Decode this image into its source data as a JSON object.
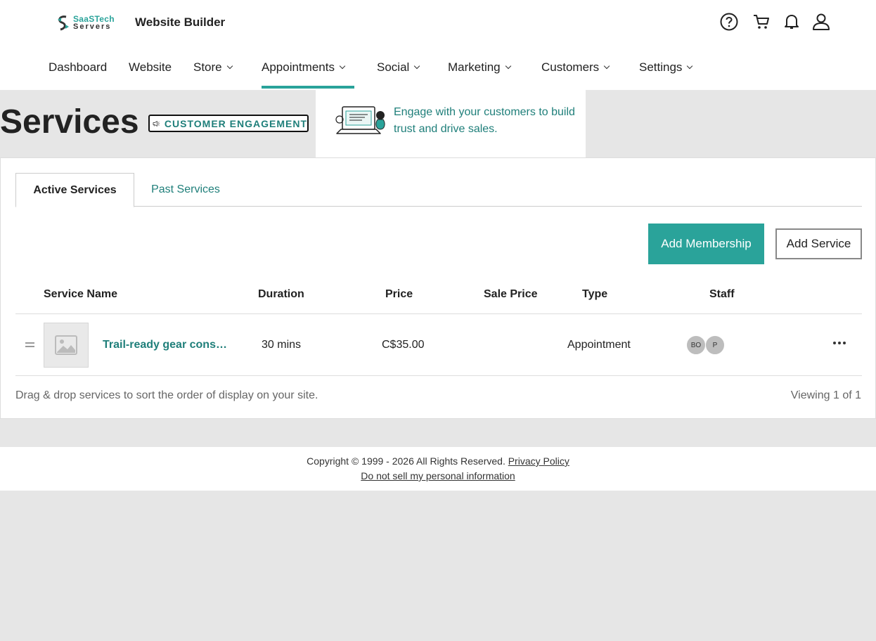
{
  "brand": {
    "logo_line1": "SaaSTech",
    "logo_line2": "Servers",
    "app_title": "Website Builder"
  },
  "header_icons": [
    "help-icon",
    "cart-icon",
    "bell-icon",
    "user-icon"
  ],
  "nav": {
    "items": [
      {
        "label": "Dashboard",
        "dropdown": false
      },
      {
        "label": "Website",
        "dropdown": false
      },
      {
        "label": "Store",
        "dropdown": true
      },
      {
        "label": "Appointments",
        "dropdown": true,
        "active": true
      },
      {
        "label": "Social",
        "dropdown": true
      },
      {
        "label": "Marketing",
        "dropdown": true
      },
      {
        "label": "Customers",
        "dropdown": true
      },
      {
        "label": "Settings",
        "dropdown": true
      }
    ]
  },
  "page": {
    "title": "Services",
    "badge_label": "CUSTOMER ENGAGEMENT",
    "popover_text": "Engage with your customers to build trust and drive sales."
  },
  "tabs": {
    "active": "Active Services",
    "inactive": "Past Services"
  },
  "actions": {
    "add_membership": "Add Membership",
    "add_service": "Add Service"
  },
  "table": {
    "headers": [
      "Service Name",
      "Duration",
      "Price",
      "Sale Price",
      "Type",
      "Staff"
    ],
    "rows": [
      {
        "name": "Trail-ready gear cons…",
        "duration": "30 mins",
        "price": "C$35.00",
        "sale_price": "",
        "type": "Appointment",
        "staff": [
          "BO",
          "P"
        ]
      }
    ]
  },
  "table_footer": {
    "note": "Drag & drop services to sort the order of display on your site.",
    "count": "Viewing 1 of 1"
  },
  "footer": {
    "copyright": "Copyright © 1999 - 2026 All Rights Reserved.",
    "privacy": "Privacy Policy",
    "do_not_sell": "Do not sell my personal information"
  },
  "colors": {
    "accent": "#2aa39a",
    "accent_text": "#1f7f7a",
    "background": "#e6e6e6"
  }
}
